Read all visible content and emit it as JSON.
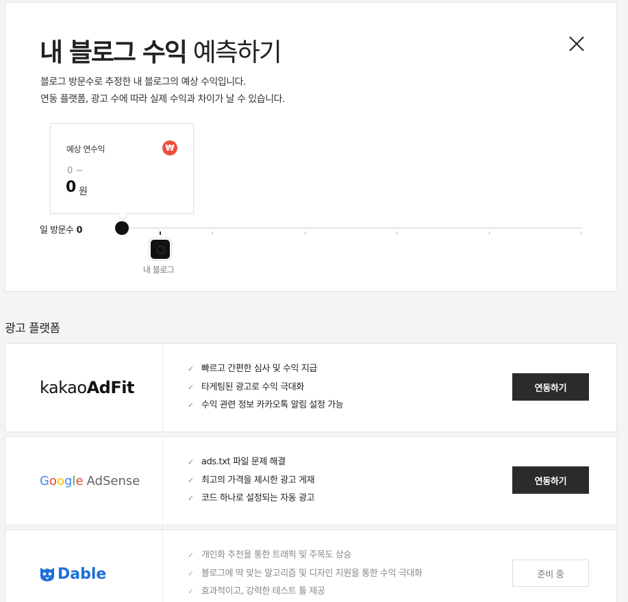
{
  "header": {
    "title_bold": "내 블로그 수익",
    "title_light": "예측하기",
    "desc_line1": "블로그 방문수로 추정한 내 블로그의 예상 수익입니다.",
    "desc_line2": "연동 플랫폼, 광고 수에 따라 실제 수익과 차이가 날 수 있습니다.",
    "close_icon": "close-icon"
  },
  "estimate_card": {
    "label": "예상 연수익",
    "won_icon_text": "₩",
    "range_text": "0 ~",
    "value": "0",
    "unit": "원"
  },
  "slider": {
    "label": "일 방문수",
    "value": "0",
    "my_blog_label": "내 블로그"
  },
  "section_title": "광고 플랫폼",
  "platforms": [
    {
      "logo_prefix": "kakao",
      "logo_bold": "AdFit",
      "features": [
        "빠르고 간편한 심사 및 수익 지급",
        "타게팅된 광고로 수익 극대화",
        "수익 관련 정보 카카오톡 알림 설정 가능"
      ],
      "button": "연동하기"
    },
    {
      "logo_letters": [
        "G",
        "o",
        "o",
        "g",
        "l",
        "e"
      ],
      "logo_suffix": "AdSense",
      "features": [
        "ads.txt 파일 문제 해결",
        "최고의 가격을 제시한 광고 게재",
        "코드 하나로 설정되는 자동 광고"
      ],
      "button": "연동하기"
    },
    {
      "logo_text": "Dable",
      "features": [
        "개인화 추천을 통한 트래픽 및 주목도 상승",
        "블로그에 딱 맞는 알고리즘 및 디자인 지원을 통한 수익 극대화",
        "효과적이고, 강력한 테스트 툴 제공"
      ],
      "button": "준비 중"
    }
  ],
  "colors": {
    "won_badge": "#f04e3e",
    "primary_button": "#2b2b2b",
    "dable_blue": "#1e6fd9"
  }
}
